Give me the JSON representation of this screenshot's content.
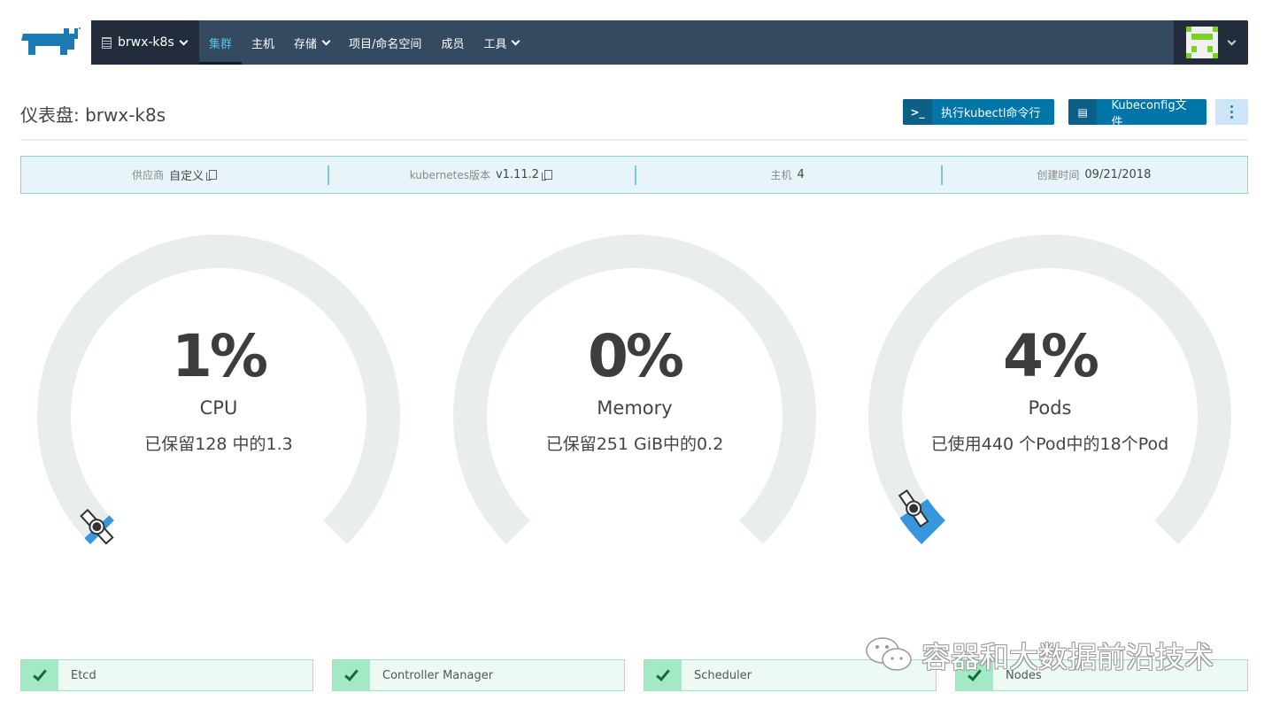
{
  "brand": {
    "logo": "rancher-logo",
    "color": "#1b7bb3"
  },
  "nav": {
    "cluster": "brwx-k8s",
    "items": [
      {
        "label": "集群",
        "active": true,
        "dropdown": false
      },
      {
        "label": "主机",
        "active": false,
        "dropdown": false
      },
      {
        "label": "存储",
        "active": false,
        "dropdown": true
      },
      {
        "label": "项目/命名空间",
        "active": false,
        "dropdown": false
      },
      {
        "label": "成员",
        "active": false,
        "dropdown": false
      },
      {
        "label": "工具",
        "active": false,
        "dropdown": true
      }
    ]
  },
  "header": {
    "title": "仪表盘: brwx-k8s",
    "kubectl_button": "执行kubectl命令行",
    "kubeconfig_button": "Kubeconfig文件"
  },
  "info": {
    "provider_label": "供应商",
    "provider_value": "自定义",
    "k8s_label": "kubernetes版本",
    "k8s_value": "v1.11.2",
    "hosts_label": "主机",
    "hosts_value": "4",
    "created_label": "创建时间",
    "created_value": "09/21/2018"
  },
  "gauges": [
    {
      "percent_text": "1%",
      "percent": 1,
      "label": "CPU",
      "detail": "已保留128 中的1.3",
      "show_needle": true
    },
    {
      "percent_text": "0%",
      "percent": 0,
      "label": "Memory",
      "detail": "已保留251 GiB中的0.2",
      "show_needle": false
    },
    {
      "percent_text": "4%",
      "percent": 4,
      "label": "Pods",
      "detail": "已使用440 个Pod中的18个Pod",
      "show_needle": true
    }
  ],
  "colors": {
    "track": "#e9edee",
    "fill": "#3796dc",
    "ok": "#a3e9c5"
  },
  "components": [
    {
      "name": "Etcd",
      "status": "ok"
    },
    {
      "name": "Controller Manager",
      "status": "ok"
    },
    {
      "name": "Scheduler",
      "status": "ok"
    },
    {
      "name": "Nodes",
      "status": "ok"
    }
  ],
  "watermark": "容器和大数据前沿技术"
}
